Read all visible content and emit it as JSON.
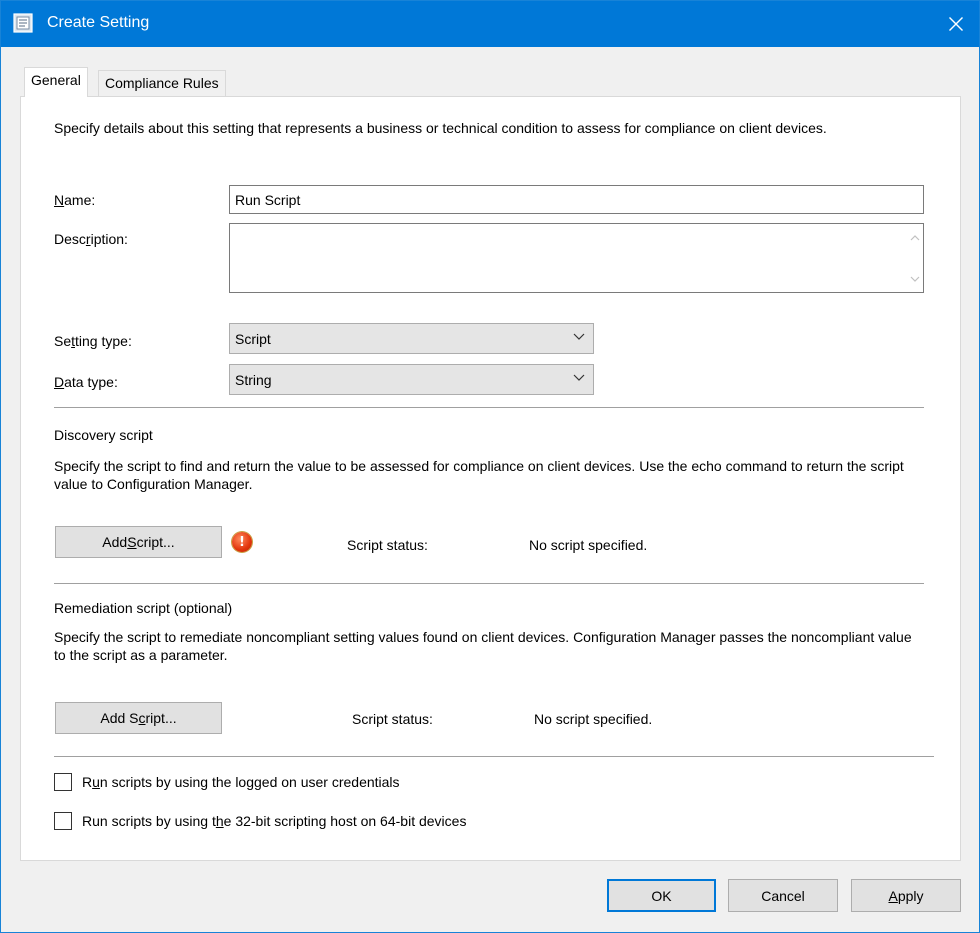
{
  "window": {
    "title": "Create Setting"
  },
  "tabs": [
    {
      "label": "General",
      "active": true
    },
    {
      "label": "Compliance Rules",
      "active": false
    }
  ],
  "general": {
    "intro": "Specify details about this setting that represents a business or technical condition to assess for compliance on client devices.",
    "name_label_pre": "",
    "name_label_key": "N",
    "name_label_post": "ame:",
    "name_value": "Run Script",
    "description_label_pre": "Desc",
    "description_label_key": "r",
    "description_label_post": "iption:",
    "description_value": "",
    "setting_type_label_pre": "Se",
    "setting_type_label_key": "t",
    "setting_type_label_post": "ting type:",
    "setting_type_value": "Script",
    "data_type_label_pre": "",
    "data_type_label_key": "D",
    "data_type_label_post": "ata type:",
    "data_type_value": "String"
  },
  "discovery": {
    "heading": "Discovery script",
    "description": "Specify the script to find and return the value to be assessed for compliance on client devices. Use the echo command to return the script value to Configuration Manager.",
    "add_pre": "Add ",
    "add_key": "S",
    "add_post": "cript...",
    "status_label": "Script status:",
    "status_value": "No script specified."
  },
  "remediation": {
    "heading": "Remediation script (optional)",
    "description": "Specify the script to remediate noncompliant setting values found on client devices. Configuration Manager passes the noncompliant value to the script as a parameter.",
    "add_pre": "Add S",
    "add_key": "c",
    "add_post": "ript...",
    "status_label": "Script status:",
    "status_value": "No script specified."
  },
  "options": {
    "logged_on_pre": "R",
    "logged_on_key": "u",
    "logged_on_post": "n scripts by using the logged on user credentials",
    "logged_on_checked": false,
    "host32_pre": "Run scripts by using t",
    "host32_key": "h",
    "host32_post": "e 32-bit scripting host on 64-bit devices",
    "host32_checked": false
  },
  "footer": {
    "ok_label": "OK",
    "cancel_label": "Cancel",
    "apply_pre": "",
    "apply_key": "A",
    "apply_post": "pply"
  },
  "colors": {
    "titlebar": "#0078d7",
    "panel": "#ffffff",
    "dialog": "#f0f0f0"
  }
}
